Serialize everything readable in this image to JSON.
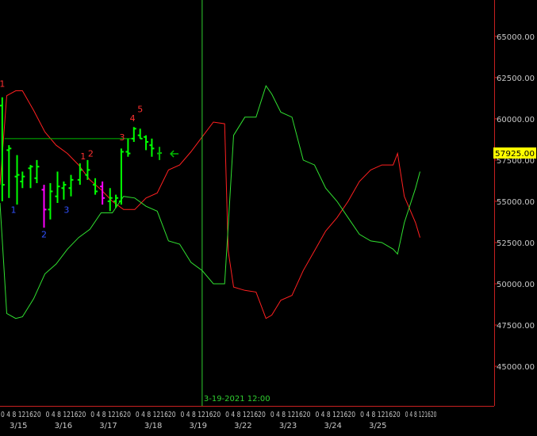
{
  "chart_data": {
    "type": "line",
    "y_ticks": [
      "65000.00",
      "62500.00",
      "60000.00",
      "57500.00",
      "55000.00",
      "52500.00",
      "50000.00",
      "47500.00",
      "45000.00"
    ],
    "y_tick_values": [
      65000,
      62500,
      60000,
      57500,
      55000,
      52500,
      50000,
      47500,
      45000
    ],
    "ylim": [
      42600,
      67200
    ],
    "hour_label_text": "0 4 8 121620",
    "date_labels": [
      "3/15",
      "3/16",
      "3/17",
      "3/18",
      "3/19",
      "3/22",
      "3/23",
      "3/24",
      "3/25"
    ],
    "x_range": [
      0,
      11
    ],
    "last_price": {
      "label": "57925.00",
      "value": 57925
    },
    "marker": {
      "label": "3-19-2021 12:00",
      "x": 4.5
    },
    "horizontal_level": {
      "value": 58800,
      "x_start": 0.1,
      "x_end": 3.0
    },
    "colors": {
      "up_bar": "#00ff00",
      "down_bar": "#ff00ff",
      "red_line": "#ff2020",
      "green_line": "#30e030",
      "label_red": "#ff3030",
      "label_blue": "#3050ff",
      "level": "#00bb00"
    },
    "bars": [
      {
        "x": 0.05,
        "h": 61300,
        "l": 55000,
        "o": 60800,
        "c": 56000,
        "color": "up"
      },
      {
        "x": 0.2,
        "h": 58400,
        "l": 55200,
        "o": 58100,
        "c": 58200,
        "color": "up"
      },
      {
        "x": 0.38,
        "h": 57800,
        "l": 54800,
        "o": 56500,
        "c": 56600,
        "color": "up"
      },
      {
        "x": 0.5,
        "h": 56800,
        "l": 55800,
        "o": 56200,
        "c": 56500,
        "color": "up"
      },
      {
        "x": 0.68,
        "h": 57200,
        "l": 55800,
        "o": 57000,
        "c": 57100,
        "color": "up"
      },
      {
        "x": 0.82,
        "h": 57500,
        "l": 56100,
        "o": 56400,
        "c": 57100,
        "color": "up"
      },
      {
        "x": 0.98,
        "h": 56000,
        "l": 53400,
        "o": 55700,
        "c": 54500,
        "color": "down"
      },
      {
        "x": 1.12,
        "h": 56100,
        "l": 53900,
        "o": 54500,
        "c": 55600,
        "color": "up"
      },
      {
        "x": 1.28,
        "h": 56800,
        "l": 54900,
        "o": 55300,
        "c": 55900,
        "color": "up"
      },
      {
        "x": 1.42,
        "h": 56200,
        "l": 55100,
        "o": 55800,
        "c": 56000,
        "color": "up"
      },
      {
        "x": 1.58,
        "h": 56600,
        "l": 55300,
        "o": 55800,
        "c": 56300,
        "color": "up"
      },
      {
        "x": 1.78,
        "h": 57300,
        "l": 56000,
        "o": 56300,
        "c": 56900,
        "color": "up"
      },
      {
        "x": 1.95,
        "h": 57500,
        "l": 56300,
        "o": 56600,
        "c": 56900,
        "color": "up"
      },
      {
        "x": 2.12,
        "h": 56400,
        "l": 55400,
        "o": 56000,
        "c": 55600,
        "color": "up"
      },
      {
        "x": 2.28,
        "h": 56200,
        "l": 54800,
        "o": 55900,
        "c": 55200,
        "color": "down"
      },
      {
        "x": 2.45,
        "h": 55800,
        "l": 54400,
        "o": 55000,
        "c": 55200,
        "color": "up"
      },
      {
        "x": 2.58,
        "h": 55400,
        "l": 54600,
        "o": 55000,
        "c": 55200,
        "color": "up"
      },
      {
        "x": 2.7,
        "h": 58200,
        "l": 54800,
        "o": 55000,
        "c": 58000,
        "color": "up"
      },
      {
        "x": 2.85,
        "h": 58800,
        "l": 57700,
        "o": 58000,
        "c": 57900,
        "color": "up"
      },
      {
        "x": 2.98,
        "h": 59500,
        "l": 58600,
        "o": 58800,
        "c": 59400,
        "color": "up"
      },
      {
        "x": 3.12,
        "h": 59400,
        "l": 58800,
        "o": 59000,
        "c": 58800,
        "color": "up"
      },
      {
        "x": 3.25,
        "h": 59000,
        "l": 58100,
        "o": 58900,
        "c": 58600,
        "color": "up"
      },
      {
        "x": 3.38,
        "h": 58800,
        "l": 57700,
        "o": 58400,
        "c": 58200,
        "color": "up"
      },
      {
        "x": 3.55,
        "h": 58300,
        "l": 57500,
        "o": 57900,
        "c": 57925,
        "color": "level"
      }
    ],
    "series": [
      {
        "color": "red",
        "points": [
          [
            0,
            56000
          ],
          [
            0.15,
            61400
          ],
          [
            0.35,
            61700
          ],
          [
            0.5,
            61700
          ],
          [
            0.75,
            60500
          ],
          [
            1.0,
            59200
          ],
          [
            1.25,
            58400
          ],
          [
            1.5,
            57900
          ],
          [
            1.75,
            57200
          ],
          [
            2.0,
            56300
          ],
          [
            2.25,
            55700
          ],
          [
            2.5,
            55000
          ],
          [
            2.75,
            54500
          ],
          [
            3.0,
            54500
          ],
          [
            3.25,
            55200
          ],
          [
            3.5,
            55500
          ],
          [
            3.75,
            56900
          ],
          [
            4.0,
            57200
          ],
          [
            4.25,
            58000
          ],
          [
            4.5,
            58900
          ],
          [
            4.75,
            59800
          ],
          [
            5.0,
            59700
          ],
          [
            5.08,
            52000
          ],
          [
            5.2,
            49800
          ],
          [
            5.45,
            49600
          ],
          [
            5.7,
            49500
          ],
          [
            5.92,
            47900
          ],
          [
            6.05,
            48100
          ],
          [
            6.25,
            49000
          ],
          [
            6.5,
            49300
          ],
          [
            6.75,
            50800
          ],
          [
            7.0,
            52000
          ],
          [
            7.25,
            53200
          ],
          [
            7.5,
            54000
          ],
          [
            7.75,
            55000
          ],
          [
            8.0,
            56200
          ],
          [
            8.25,
            56900
          ],
          [
            8.5,
            57200
          ],
          [
            8.75,
            57200
          ],
          [
            8.85,
            57900
          ],
          [
            9.0,
            55300
          ],
          [
            9.25,
            53700
          ],
          [
            9.35,
            52800
          ]
        ]
      },
      {
        "color": "green",
        "points": [
          [
            0,
            54900
          ],
          [
            0.15,
            48200
          ],
          [
            0.35,
            47900
          ],
          [
            0.5,
            48000
          ],
          [
            0.75,
            49100
          ],
          [
            1.0,
            50600
          ],
          [
            1.25,
            51200
          ],
          [
            1.5,
            52100
          ],
          [
            1.75,
            52800
          ],
          [
            2.0,
            53300
          ],
          [
            2.25,
            54300
          ],
          [
            2.5,
            54300
          ],
          [
            2.75,
            55300
          ],
          [
            3.0,
            55200
          ],
          [
            3.25,
            54700
          ],
          [
            3.5,
            54400
          ],
          [
            3.75,
            52600
          ],
          [
            4.0,
            52400
          ],
          [
            4.25,
            51300
          ],
          [
            4.5,
            50800
          ],
          [
            4.75,
            50000
          ],
          [
            5.0,
            50000
          ],
          [
            5.08,
            53500
          ],
          [
            5.2,
            59000
          ],
          [
            5.45,
            60100
          ],
          [
            5.7,
            60100
          ],
          [
            5.92,
            62000
          ],
          [
            6.05,
            61500
          ],
          [
            6.25,
            60400
          ],
          [
            6.5,
            60100
          ],
          [
            6.75,
            57500
          ],
          [
            7.0,
            57200
          ],
          [
            7.25,
            55800
          ],
          [
            7.5,
            55000
          ],
          [
            7.75,
            54000
          ],
          [
            8.0,
            53000
          ],
          [
            8.25,
            52600
          ],
          [
            8.5,
            52500
          ],
          [
            8.75,
            52100
          ],
          [
            8.85,
            51800
          ],
          [
            9.0,
            53700
          ],
          [
            9.25,
            55800
          ],
          [
            9.35,
            56800
          ]
        ]
      }
    ],
    "wave_labels": [
      {
        "text": "1",
        "x": 0.05,
        "y": 61950,
        "color": "red"
      },
      {
        "text": "1",
        "x": 0.3,
        "y": 54300,
        "color": "blue"
      },
      {
        "text": "2",
        "x": 0.98,
        "y": 52800,
        "color": "blue"
      },
      {
        "text": "3",
        "x": 1.48,
        "y": 54300,
        "color": "blue"
      },
      {
        "text": "1",
        "x": 1.85,
        "y": 57550,
        "color": "red"
      },
      {
        "text": "2",
        "x": 2.02,
        "y": 57700,
        "color": "red"
      },
      {
        "text": "3",
        "x": 2.72,
        "y": 58700,
        "color": "red"
      },
      {
        "text": "4",
        "x": 2.95,
        "y": 59850,
        "color": "red"
      },
      {
        "text": "5",
        "x": 3.12,
        "y": 60400,
        "color": "red"
      }
    ]
  }
}
